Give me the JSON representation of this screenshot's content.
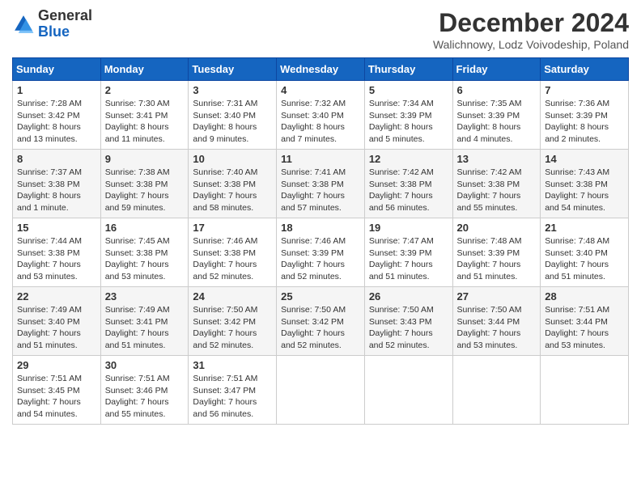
{
  "header": {
    "logo_line1": "General",
    "logo_line2": "Blue",
    "month_title": "December 2024",
    "subtitle": "Walichnowy, Lodz Voivodeship, Poland"
  },
  "weekdays": [
    "Sunday",
    "Monday",
    "Tuesday",
    "Wednesday",
    "Thursday",
    "Friday",
    "Saturday"
  ],
  "weeks": [
    [
      {
        "day": "1",
        "sunrise": "Sunrise: 7:28 AM",
        "sunset": "Sunset: 3:42 PM",
        "daylight": "Daylight: 8 hours and 13 minutes."
      },
      {
        "day": "2",
        "sunrise": "Sunrise: 7:30 AM",
        "sunset": "Sunset: 3:41 PM",
        "daylight": "Daylight: 8 hours and 11 minutes."
      },
      {
        "day": "3",
        "sunrise": "Sunrise: 7:31 AM",
        "sunset": "Sunset: 3:40 PM",
        "daylight": "Daylight: 8 hours and 9 minutes."
      },
      {
        "day": "4",
        "sunrise": "Sunrise: 7:32 AM",
        "sunset": "Sunset: 3:40 PM",
        "daylight": "Daylight: 8 hours and 7 minutes."
      },
      {
        "day": "5",
        "sunrise": "Sunrise: 7:34 AM",
        "sunset": "Sunset: 3:39 PM",
        "daylight": "Daylight: 8 hours and 5 minutes."
      },
      {
        "day": "6",
        "sunrise": "Sunrise: 7:35 AM",
        "sunset": "Sunset: 3:39 PM",
        "daylight": "Daylight: 8 hours and 4 minutes."
      },
      {
        "day": "7",
        "sunrise": "Sunrise: 7:36 AM",
        "sunset": "Sunset: 3:39 PM",
        "daylight": "Daylight: 8 hours and 2 minutes."
      }
    ],
    [
      {
        "day": "8",
        "sunrise": "Sunrise: 7:37 AM",
        "sunset": "Sunset: 3:38 PM",
        "daylight": "Daylight: 8 hours and 1 minute."
      },
      {
        "day": "9",
        "sunrise": "Sunrise: 7:38 AM",
        "sunset": "Sunset: 3:38 PM",
        "daylight": "Daylight: 7 hours and 59 minutes."
      },
      {
        "day": "10",
        "sunrise": "Sunrise: 7:40 AM",
        "sunset": "Sunset: 3:38 PM",
        "daylight": "Daylight: 7 hours and 58 minutes."
      },
      {
        "day": "11",
        "sunrise": "Sunrise: 7:41 AM",
        "sunset": "Sunset: 3:38 PM",
        "daylight": "Daylight: 7 hours and 57 minutes."
      },
      {
        "day": "12",
        "sunrise": "Sunrise: 7:42 AM",
        "sunset": "Sunset: 3:38 PM",
        "daylight": "Daylight: 7 hours and 56 minutes."
      },
      {
        "day": "13",
        "sunrise": "Sunrise: 7:42 AM",
        "sunset": "Sunset: 3:38 PM",
        "daylight": "Daylight: 7 hours and 55 minutes."
      },
      {
        "day": "14",
        "sunrise": "Sunrise: 7:43 AM",
        "sunset": "Sunset: 3:38 PM",
        "daylight": "Daylight: 7 hours and 54 minutes."
      }
    ],
    [
      {
        "day": "15",
        "sunrise": "Sunrise: 7:44 AM",
        "sunset": "Sunset: 3:38 PM",
        "daylight": "Daylight: 7 hours and 53 minutes."
      },
      {
        "day": "16",
        "sunrise": "Sunrise: 7:45 AM",
        "sunset": "Sunset: 3:38 PM",
        "daylight": "Daylight: 7 hours and 53 minutes."
      },
      {
        "day": "17",
        "sunrise": "Sunrise: 7:46 AM",
        "sunset": "Sunset: 3:38 PM",
        "daylight": "Daylight: 7 hours and 52 minutes."
      },
      {
        "day": "18",
        "sunrise": "Sunrise: 7:46 AM",
        "sunset": "Sunset: 3:39 PM",
        "daylight": "Daylight: 7 hours and 52 minutes."
      },
      {
        "day": "19",
        "sunrise": "Sunrise: 7:47 AM",
        "sunset": "Sunset: 3:39 PM",
        "daylight": "Daylight: 7 hours and 51 minutes."
      },
      {
        "day": "20",
        "sunrise": "Sunrise: 7:48 AM",
        "sunset": "Sunset: 3:39 PM",
        "daylight": "Daylight: 7 hours and 51 minutes."
      },
      {
        "day": "21",
        "sunrise": "Sunrise: 7:48 AM",
        "sunset": "Sunset: 3:40 PM",
        "daylight": "Daylight: 7 hours and 51 minutes."
      }
    ],
    [
      {
        "day": "22",
        "sunrise": "Sunrise: 7:49 AM",
        "sunset": "Sunset: 3:40 PM",
        "daylight": "Daylight: 7 hours and 51 minutes."
      },
      {
        "day": "23",
        "sunrise": "Sunrise: 7:49 AM",
        "sunset": "Sunset: 3:41 PM",
        "daylight": "Daylight: 7 hours and 51 minutes."
      },
      {
        "day": "24",
        "sunrise": "Sunrise: 7:50 AM",
        "sunset": "Sunset: 3:42 PM",
        "daylight": "Daylight: 7 hours and 52 minutes."
      },
      {
        "day": "25",
        "sunrise": "Sunrise: 7:50 AM",
        "sunset": "Sunset: 3:42 PM",
        "daylight": "Daylight: 7 hours and 52 minutes."
      },
      {
        "day": "26",
        "sunrise": "Sunrise: 7:50 AM",
        "sunset": "Sunset: 3:43 PM",
        "daylight": "Daylight: 7 hours and 52 minutes."
      },
      {
        "day": "27",
        "sunrise": "Sunrise: 7:50 AM",
        "sunset": "Sunset: 3:44 PM",
        "daylight": "Daylight: 7 hours and 53 minutes."
      },
      {
        "day": "28",
        "sunrise": "Sunrise: 7:51 AM",
        "sunset": "Sunset: 3:44 PM",
        "daylight": "Daylight: 7 hours and 53 minutes."
      }
    ],
    [
      {
        "day": "29",
        "sunrise": "Sunrise: 7:51 AM",
        "sunset": "Sunset: 3:45 PM",
        "daylight": "Daylight: 7 hours and 54 minutes."
      },
      {
        "day": "30",
        "sunrise": "Sunrise: 7:51 AM",
        "sunset": "Sunset: 3:46 PM",
        "daylight": "Daylight: 7 hours and 55 minutes."
      },
      {
        "day": "31",
        "sunrise": "Sunrise: 7:51 AM",
        "sunset": "Sunset: 3:47 PM",
        "daylight": "Daylight: 7 hours and 56 minutes."
      },
      null,
      null,
      null,
      null
    ]
  ]
}
